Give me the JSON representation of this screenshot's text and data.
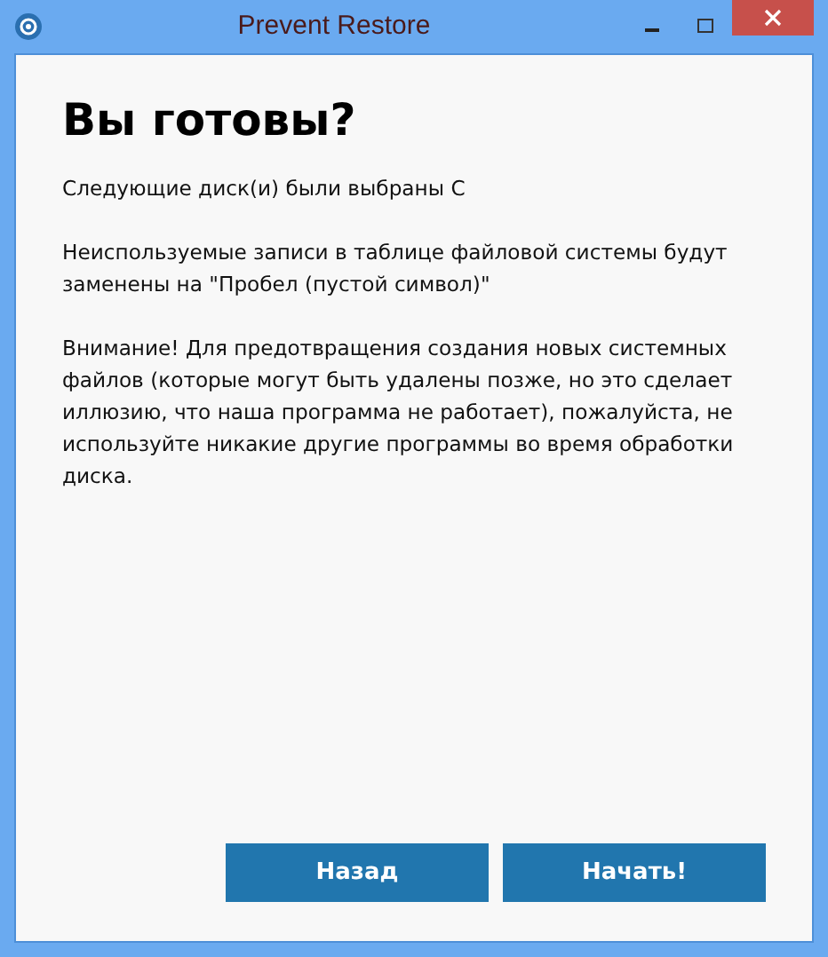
{
  "window": {
    "title": "Prevent Restore"
  },
  "heading": "Вы готовы?",
  "paragraphs": [
    "Следующие диск(и) были выбраны C",
    "Неиспользуемые записи в таблице файловой системы будут заменены на \"Пробел (пустой символ)\"",
    "Внимание! Для предотвращения создания новых системных файлов (которые могут быть удалены позже, но это сделает иллюзию, что наша программа не работает), пожалуйста, не используйте никакие другие программы во время обработки диска."
  ],
  "buttons": [
    "Назад",
    "Начать!"
  ]
}
